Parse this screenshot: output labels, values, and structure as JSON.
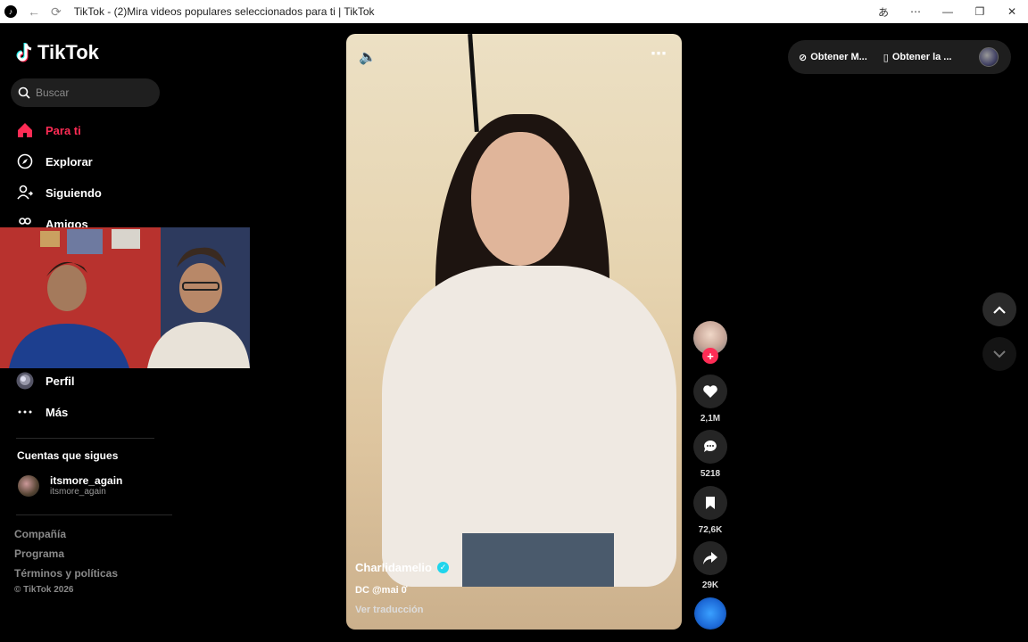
{
  "window": {
    "title": "TikTok - (2)Mira videos populares seleccionados para ti | TikTok"
  },
  "sidebar": {
    "logo_text": "TikTok",
    "search_placeholder": "Buscar",
    "nav": [
      {
        "label": "Para ti",
        "icon": "home-icon",
        "active": true
      },
      {
        "label": "Explorar",
        "icon": "compass-icon",
        "active": false
      },
      {
        "label": "Siguiendo",
        "icon": "user-follow-icon",
        "active": false
      },
      {
        "label": "Amigos",
        "icon": "friends-icon",
        "active": false
      },
      {
        "label": "Perfil",
        "icon": "avatar",
        "active": false
      },
      {
        "label": "Más",
        "icon": "more-icon",
        "active": false
      }
    ],
    "following_title": "Cuentas que sigues",
    "following": [
      {
        "name": "itsmore_again",
        "handle": "itsmore_again"
      }
    ],
    "footer_links": [
      "Compañía",
      "Programa",
      "Términos y políticas"
    ],
    "copyright": "© TikTok 2026"
  },
  "video": {
    "author": "Charlidamelio",
    "caption": "DC @mai 0҆",
    "translate_label": "Ver traducción"
  },
  "actions": {
    "likes": "2,1M",
    "comments": "5218",
    "saves": "72,6K",
    "shares": "29K"
  },
  "header": {
    "get_coins_label": "Obtener M...",
    "get_app_label": "Obtener la ..."
  },
  "colors": {
    "accent": "#fe2c55",
    "verified": "#20d5ec",
    "background": "#000000"
  }
}
